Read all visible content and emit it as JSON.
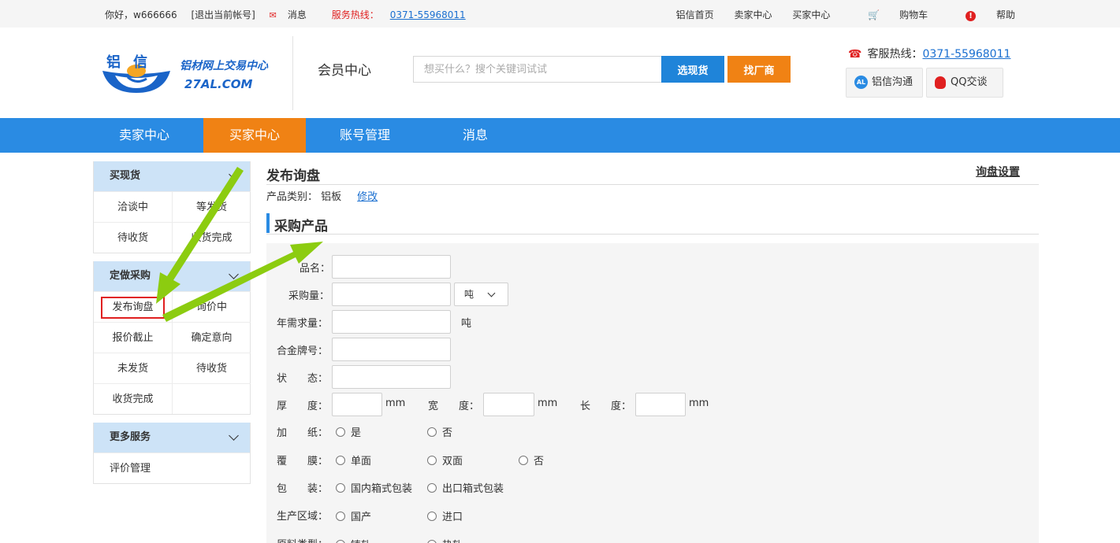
{
  "topbar": {
    "greeting": "你好，w666666",
    "logout": "[退出当前帐号]",
    "messages": "消息",
    "hotline_label": "服务热线：",
    "hotline": "0371-55968011",
    "links": [
      "铝信首页",
      "卖家中心",
      "买家中心"
    ],
    "cart": "购物车",
    "help": "帮助"
  },
  "header": {
    "logo_chars": "铝信",
    "logo_slogan": "铝材网上交易中心",
    "logo_domain": "27AL.COM",
    "member_center": "会员中心",
    "search_placeholder": "想买什么？搜个关键词试试",
    "btn_xuan": "选现货",
    "btn_zhao": "找厂商",
    "service_label": "客服热线：",
    "service_phone": "0371-55968011",
    "chat1": "铝信沟通",
    "chat2": "QQ交谈",
    "al_icon_text": "AL"
  },
  "nav": {
    "items": [
      "卖家中心",
      "买家中心",
      "账号管理",
      "消息"
    ],
    "active_index": 1
  },
  "sidebar": {
    "groups": [
      {
        "title": "买现货",
        "items": [
          "洽谈中",
          "等发货",
          "待收货",
          "收货完成"
        ]
      },
      {
        "title": "定做采购",
        "items": [
          "发布询盘",
          "询价中",
          "报价截止",
          "确定意向",
          "未发货",
          "待收货",
          "收货完成",
          ""
        ]
      },
      {
        "title": "更多服务",
        "items": [
          "评价管理"
        ]
      }
    ],
    "highlighted_item": "发布询盘"
  },
  "content": {
    "title": "发布询盘",
    "setting_link": "询盘设置",
    "category_label": "产品类别：",
    "category_value": "铝板",
    "modify": "修改",
    "section_title": "采购产品",
    "form": {
      "name_label": "品名：",
      "qty_label": "采购量：",
      "qty_unit": "吨",
      "annual_label": "年需求量：",
      "annual_unit": "吨",
      "alloy_label": "合金牌号：",
      "state_label": "状　　态：",
      "thickness_label": "厚　　度：",
      "width_label": "宽　　度：",
      "length_label": "长　　度：",
      "mm": "mm",
      "paper_label": "加　　纸：",
      "paper_options": [
        "是",
        "否"
      ],
      "film_label": "覆　　膜：",
      "film_options": [
        "单面",
        "双面",
        "否"
      ],
      "pack_label": "包　　装：",
      "pack_options": [
        "国内箱式包装",
        "出口箱式包装"
      ],
      "region_label": "生产区域：",
      "region_options": [
        "国产",
        "进口"
      ],
      "material_label": "原料类型：",
      "material_options": [
        "铸轧",
        "热轧"
      ]
    }
  },
  "colors": {
    "nav_blue": "#2a8be3",
    "active_orange": "#f08214",
    "hotline_red": "#e02020",
    "arrow_green": "#8ccc10",
    "sidebar_head": "#cde3f7"
  }
}
